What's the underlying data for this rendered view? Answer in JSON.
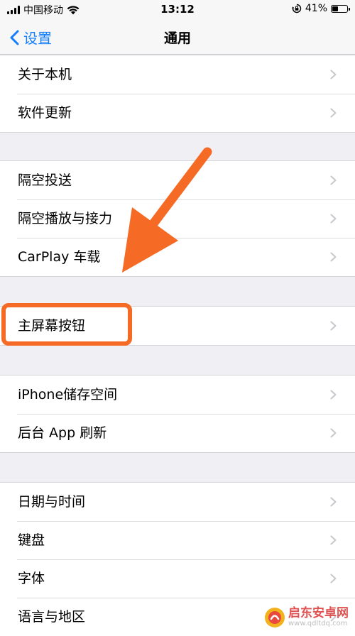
{
  "status_bar": {
    "carrier": "中国移动",
    "time": "13:12",
    "battery": "41%",
    "battery_level": 0.41
  },
  "nav": {
    "back_label": "设置",
    "title": "通用"
  },
  "groups": [
    {
      "items": [
        {
          "label": "关于本机"
        },
        {
          "label": "软件更新"
        }
      ]
    },
    {
      "items": [
        {
          "label": "隔空投送"
        },
        {
          "label": "隔空播放与接力"
        },
        {
          "label": "CarPlay 车载"
        }
      ]
    },
    {
      "items": [
        {
          "label": "主屏幕按钮"
        }
      ]
    },
    {
      "items": [
        {
          "label": "iPhone储存空间"
        },
        {
          "label": "后台 App 刷新"
        }
      ]
    },
    {
      "items": [
        {
          "label": "日期与时间"
        },
        {
          "label": "键盘"
        },
        {
          "label": "字体"
        },
        {
          "label": "语言与地区"
        }
      ]
    }
  ],
  "watermark": {
    "name": "启东安卓网",
    "url": "www.qdltdq.com"
  },
  "colors": {
    "accent": "#147efb",
    "annotation": "#f56a24",
    "background": "#efeff4",
    "chevron": "#c7c7cc"
  }
}
